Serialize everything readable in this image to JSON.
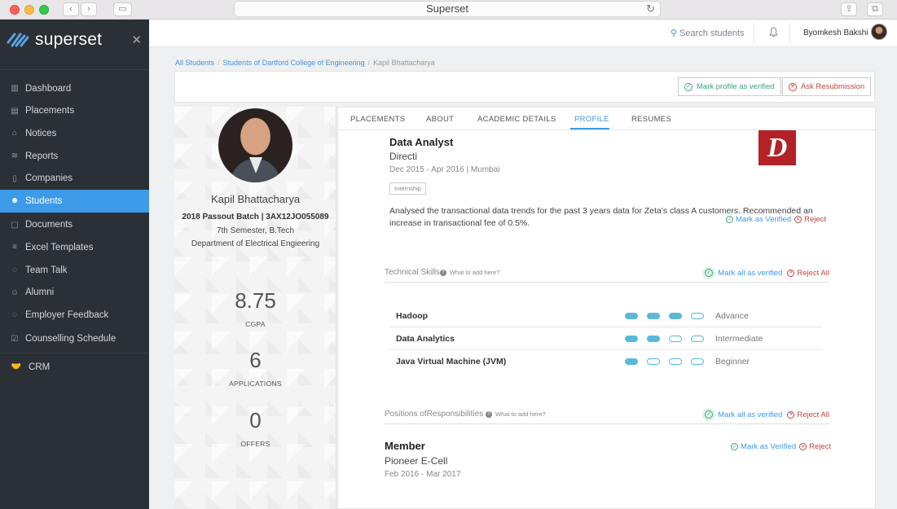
{
  "browser": {
    "url_title": "Superset"
  },
  "sidebar": {
    "brand": "superset",
    "items": [
      {
        "label": "Dashboard",
        "icon": "dashboard-icon"
      },
      {
        "label": "Placements",
        "icon": "placements-icon"
      },
      {
        "label": "Notices",
        "icon": "notices-icon"
      },
      {
        "label": "Reports",
        "icon": "reports-icon"
      },
      {
        "label": "Companies",
        "icon": "companies-icon"
      },
      {
        "label": "Students",
        "icon": "students-icon"
      },
      {
        "label": "Documents",
        "icon": "documents-icon"
      },
      {
        "label": "Excel Templates",
        "icon": "excel-templates-icon"
      },
      {
        "label": "Team Talk",
        "icon": "team-talk-icon"
      },
      {
        "label": "Alumni",
        "icon": "alumni-icon"
      },
      {
        "label": "Employer Feedback",
        "icon": "employer-feedback-icon"
      },
      {
        "label": "Counselling Schedule",
        "icon": "counselling-icon"
      },
      {
        "label": "CRM",
        "icon": "crm-icon"
      }
    ],
    "active": "Students"
  },
  "topbar": {
    "search_label": "Search students",
    "user_name": "Byomkesh Bakshi"
  },
  "breadcrumb": {
    "items": [
      "All Students",
      "Students of Dartford College of Engineering",
      "Kapil Bhattacharya"
    ]
  },
  "actions": {
    "verify_label": "Mark profile as verified",
    "resubmit_label": "Ask Resubmission"
  },
  "profile": {
    "name": "Kapil Bhattacharya",
    "batch": "2018 Passout Batch | 3AX12JO055089",
    "semester": "7th Semester, B.Tech",
    "department": "Department of Electrical Engieering",
    "stats": [
      {
        "value": "8.75",
        "label": "CGPA"
      },
      {
        "value": "6",
        "label": "APPLICATIONS"
      },
      {
        "value": "0",
        "label": "OFFERS"
      }
    ]
  },
  "tabs": {
    "items": [
      "PLACEMENTS",
      "ABOUT",
      "ACADEMIC DETAILS",
      "PROFILE",
      "RESUMES"
    ],
    "active": "PROFILE"
  },
  "experience": {
    "title": "Data Analyst",
    "company": "Directi",
    "dates": "Dec 2015 - Apr 2016 | Mumbai",
    "tag": "Internship",
    "description": "Analysed the transactional data trends for the past 3 years data for Zeta's class A customers. Recommended an increase in transactional fee of 0.5%.",
    "logo_letter": "D",
    "logo_color": "#b22226",
    "verify_label": "Mark as Verified",
    "reject_label": "Reject"
  },
  "technical_skills": {
    "title": "Technical Skills",
    "help": "What to add here?",
    "mark_all": "Mark all as verified",
    "reject_all": "Reject All",
    "items": [
      {
        "name": "Hadoop",
        "level": "Advance",
        "rating": 3,
        "max": 4
      },
      {
        "name": "Data Analytics",
        "level": "Intermediate",
        "rating": 2,
        "max": 4
      },
      {
        "name": "Java Virtual Machine (JVM)",
        "level": "Beginner",
        "rating": 1,
        "max": 4
      }
    ]
  },
  "responsibilities": {
    "title": "Positions ofResponsibilities",
    "help": "What to add here?",
    "mark_all": "Mark all as verified",
    "reject_all": "Reject All",
    "item": {
      "title": "Member",
      "org": "Pioneer E-Cell",
      "dates": "Feb 2016 - Mar 2017",
      "verify_label": "Mark as Verified",
      "reject_label": "Reject"
    }
  },
  "colors": {
    "accent": "#3d9ae8",
    "sidebar_bg": "#2b2f36",
    "verify_green": "#3aa679",
    "reject_red": "#c0453f",
    "skill_dot": "#5ab8d8"
  }
}
